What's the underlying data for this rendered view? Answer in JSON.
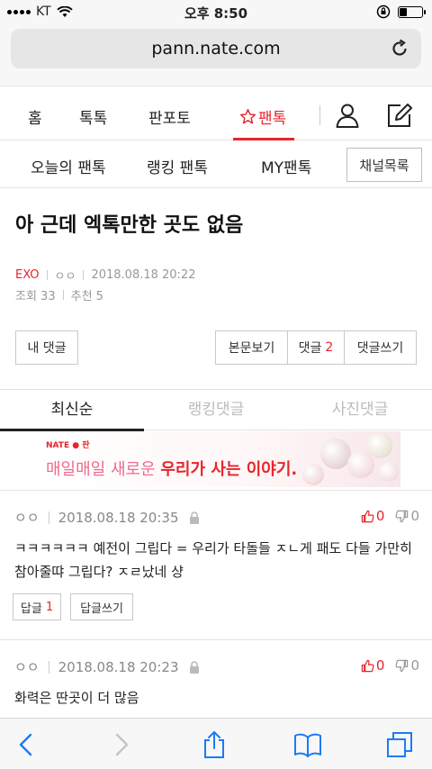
{
  "status": {
    "carrier": "KT",
    "time": "오후 8:50"
  },
  "browser": {
    "url": "pann.nate.com"
  },
  "nav": {
    "home": "홈",
    "toktok": "톡톡",
    "panpoto": "판포토",
    "pantok": "팬톡"
  },
  "subnav": {
    "today": "오늘의 팬톡",
    "ranking": "랭킹 팬톡",
    "my": "MY팬톡",
    "channel_list": "채널목록"
  },
  "post": {
    "title": "아 근데 엑톡만한 곳도 없음",
    "channel": "EXO",
    "author": "ㅇㅇ",
    "datetime": "2018.08.18 20:22",
    "views_label": "조회 33",
    "recommend_label": "추천 5"
  },
  "buttons": {
    "my_comments": "내 댓글",
    "view_body": "본문보기",
    "comments_label": "댓글",
    "comments_count": "2",
    "write_comment": "댓글쓰기"
  },
  "comment_tabs": [
    "최신순",
    "랭킹댓글",
    "사진댓글"
  ],
  "banner": {
    "brand": "NATE ● 판",
    "text_plain": "매일매일 새로운 ",
    "text_bold": "우리가 사는 이야기."
  },
  "comments": [
    {
      "author": "ㅇㅇ",
      "datetime": "2018.08.18 20:35",
      "up": "0",
      "down": "0",
      "text": "ㅋㅋㅋㅋㅋㅋ 예전이 그립다 = 우리가 타돌들 ㅈㄴ게 패도 다들 가만히 참아줄땨 그립다? ㅈㄹ났네 샹",
      "reply_label": "답글",
      "reply_count": "1",
      "write_reply": "답글쓰기"
    },
    {
      "author": "ㅇㅇ",
      "datetime": "2018.08.18 20:23",
      "up": "0",
      "down": "0",
      "text": "화력은 딴곳이 더 많음"
    }
  ],
  "colors": {
    "accent": "#e8242b",
    "banner_pink": "#f06a8a"
  }
}
